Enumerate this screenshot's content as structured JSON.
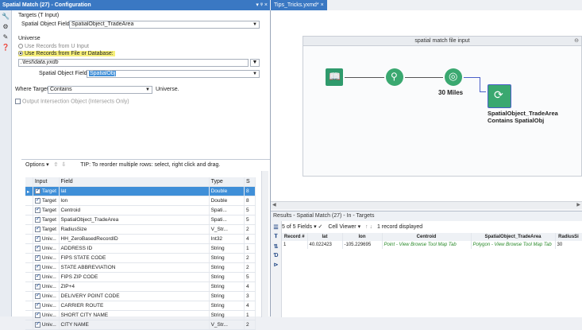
{
  "left_panel": {
    "title": "Spatial Match (27) - Configuration",
    "title_controls": "▾ ᵠ ×",
    "targets_label": "Targets (T Input)",
    "spatial_object_field_label": "Spatial Object Field:",
    "spatial_object_field_value": "SpatialObject_TradeArea",
    "universe_label": "Universe",
    "use_records_u_input": "Use Records from U Input",
    "use_records_file": "Use Records from File or Database:",
    "file_path": ".\\test\\data.yxdb",
    "universe_spatial_field_label": "Spatial Object Field:",
    "universe_spatial_field_value": "SpatialObj",
    "where_target_label": "Where Target",
    "where_target_value": "Contains",
    "where_target_suffix": "Universe.",
    "output_intersection_label": "Output Intersection Object (Intersects Only)"
  },
  "grid": {
    "options_label": "Options ▾",
    "tip": "TIP: To reorder multiple rows: select, right click and drag.",
    "columns": [
      "",
      "Input",
      "Field",
      "Type",
      "S"
    ],
    "rows": [
      {
        "input": "Target",
        "field": "lat",
        "type": "Double",
        "s": "8",
        "selected": true
      },
      {
        "input": "Target",
        "field": "lon",
        "type": "Double",
        "s": "8"
      },
      {
        "input": "Target",
        "field": "Centroid",
        "type": "Spati...",
        "s": "5"
      },
      {
        "input": "Target",
        "field": "SpatialObject_TradeArea",
        "type": "Spati...",
        "s": "5"
      },
      {
        "input": "Target",
        "field": "RadiusSize",
        "type": "V_Str...",
        "s": "2"
      },
      {
        "input": "Univ...",
        "field": "HH_ZeroBasedRecordID",
        "type": "Int32",
        "s": "4"
      },
      {
        "input": "Univ...",
        "field": "ADDRESS ID",
        "type": "String",
        "s": "1"
      },
      {
        "input": "Univ...",
        "field": "FIPS STATE CODE",
        "type": "String",
        "s": "2"
      },
      {
        "input": "Univ...",
        "field": "STATE ABBREVIATION",
        "type": "String",
        "s": "2"
      },
      {
        "input": "Univ...",
        "field": "FIPS ZIP CODE",
        "type": "String",
        "s": "5"
      },
      {
        "input": "Univ...",
        "field": "ZIP+4",
        "type": "String",
        "s": "4"
      },
      {
        "input": "Univ...",
        "field": "DELIVERY POINT CODE",
        "type": "String",
        "s": "3"
      },
      {
        "input": "Univ...",
        "field": "CARRIER ROUTE",
        "type": "String",
        "s": "4"
      },
      {
        "input": "Univ...",
        "field": "SHORT CITY NAME",
        "type": "String",
        "s": "1"
      },
      {
        "input": "Univ...",
        "field": "CITY NAME",
        "type": "V_Str...",
        "s": "2"
      }
    ]
  },
  "workflow": {
    "tab_label": "Tips_Tricks.yxmd* ×",
    "container_title": "spatial match file input",
    "tool_label_radius": "30 Miles",
    "tool_label_match": "SpatialObject_TradeArea Contains SpatialObj"
  },
  "results": {
    "title": "Results - Spatial Match (27) - In - Targets",
    "fields_label": "5 of 5 Fields ▾ ✓",
    "viewer_label": "Cell Viewer ▾",
    "records_label": "1 record displayed",
    "columns": [
      "Record #",
      "lat",
      "lon",
      "Centroid",
      "SpatialObject_TradeArea",
      "RadiusSi"
    ],
    "row": [
      "1",
      "40.022423",
      "-105.229695",
      "Point - View Browse Tool Map Tab",
      "Polygon - View Browse Tool Map Tab",
      "30"
    ]
  },
  "colors": {
    "accent": "#3a78c3",
    "selected_row": "#3f8fd8",
    "highlight": "#f7f07a"
  }
}
